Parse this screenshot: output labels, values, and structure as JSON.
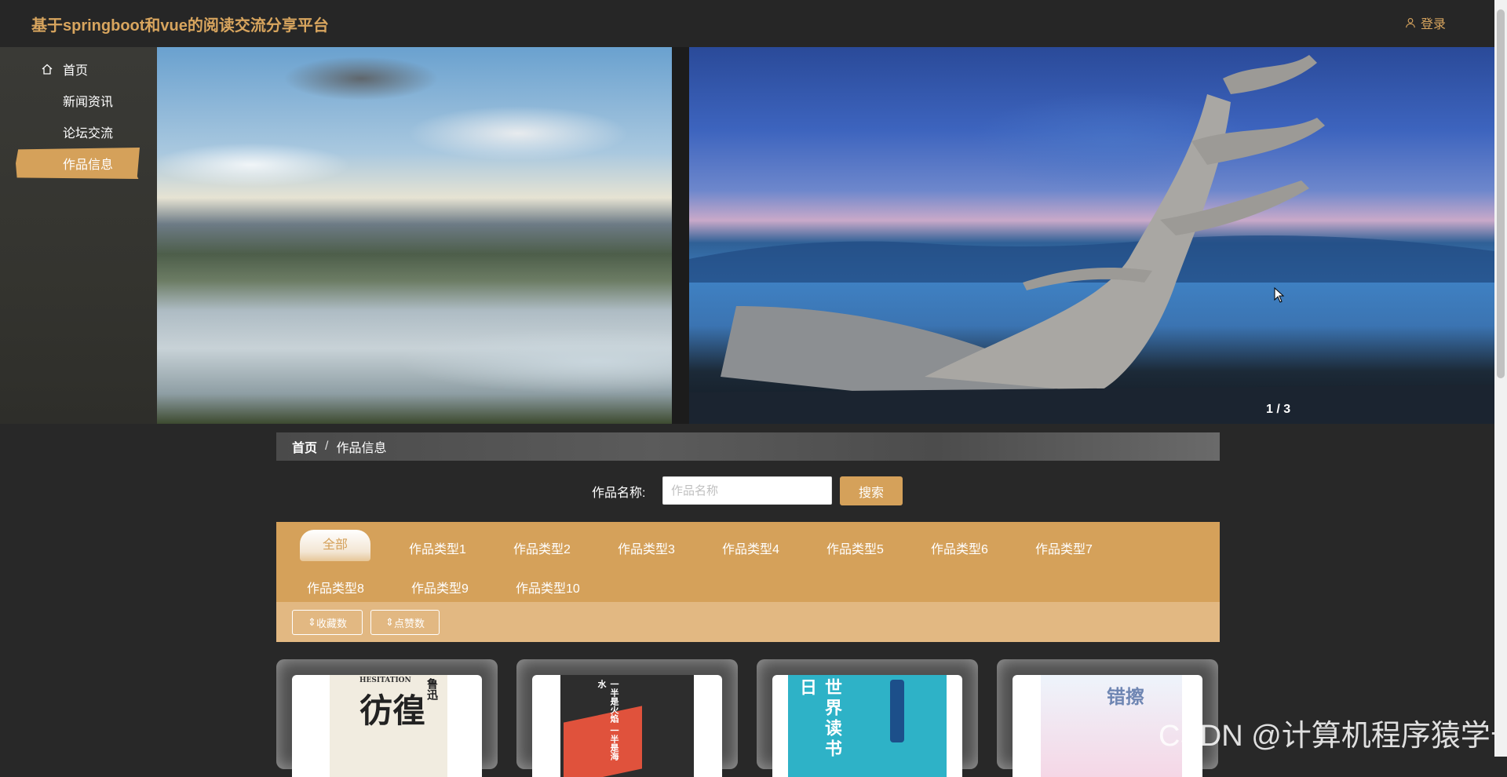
{
  "header": {
    "title": "基于springboot和vue的阅读交流分享平台",
    "login_label": "登录"
  },
  "sidebar": {
    "items": [
      {
        "label": "首页",
        "icon": "home-icon"
      },
      {
        "label": "新闻资讯"
      },
      {
        "label": "论坛交流"
      },
      {
        "label": "作品信息",
        "active": true
      }
    ]
  },
  "banner": {
    "counter": "1 / 3",
    "current": 1,
    "total": 3
  },
  "breadcrumb": {
    "home": "首页",
    "separator": "/",
    "current": "作品信息"
  },
  "search": {
    "label": "作品名称:",
    "placeholder": "作品名称",
    "value": "",
    "button": "搜索"
  },
  "categories": [
    "全部",
    "作品类型1",
    "作品类型2",
    "作品类型3",
    "作品类型4",
    "作品类型5",
    "作品类型6",
    "作品类型7",
    "作品类型8",
    "作品类型9",
    "作品类型10"
  ],
  "sort": {
    "collect": "收藏数",
    "like": "点赞数"
  },
  "books": [
    {
      "cover_text": "彷徨",
      "author_text": "鲁迅",
      "subtitle": "HESITATION"
    },
    {
      "cover_text": "一半是火焰 一半是海水"
    },
    {
      "cover_text": "世界读书日"
    },
    {
      "cover_text": "错擦"
    }
  ],
  "watermark": "CSDN @计算机程序猿学长",
  "colors": {
    "accent": "#d5a15a",
    "background": "#282828",
    "topbar": "#262626"
  }
}
